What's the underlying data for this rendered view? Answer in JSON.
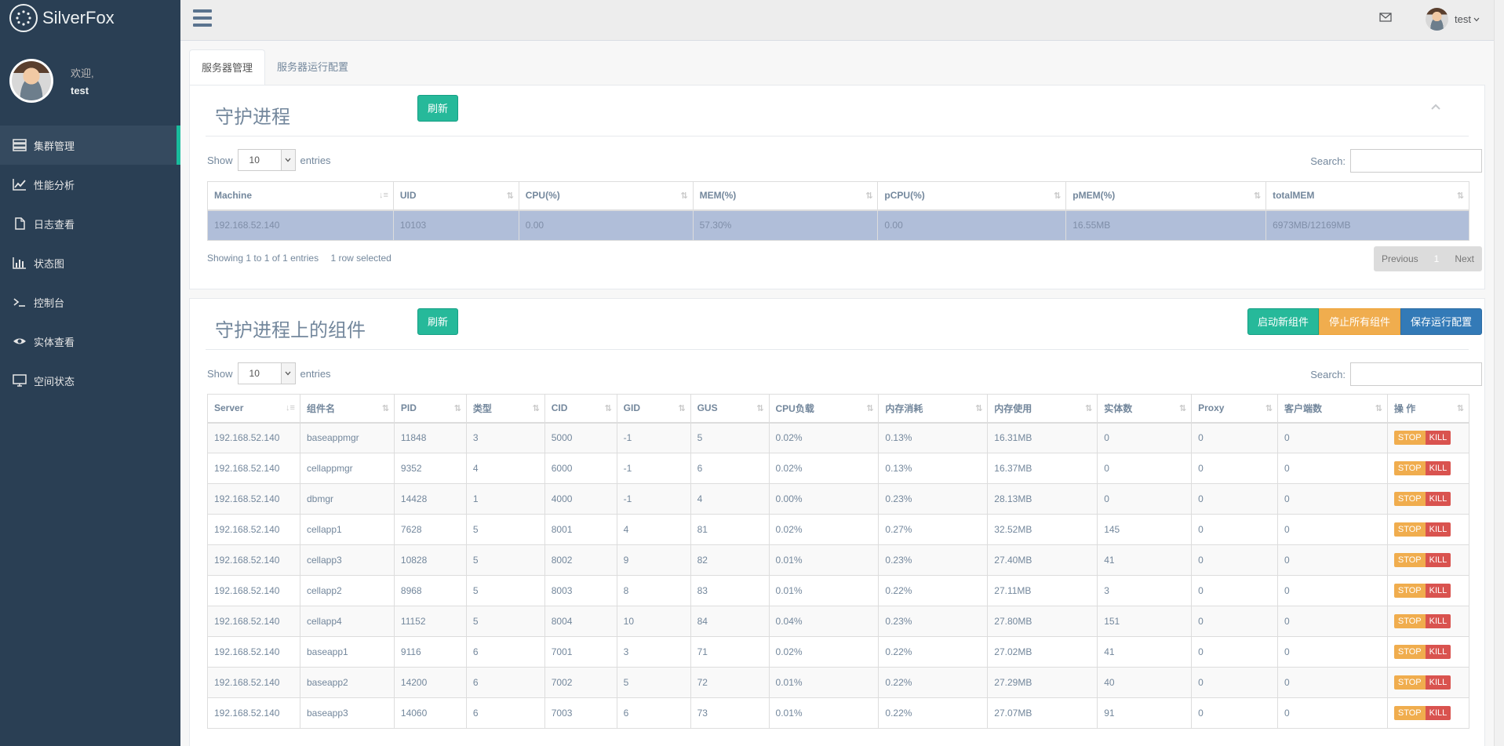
{
  "brand": {
    "name": "SilverFox"
  },
  "profile": {
    "welcome": "欢迎,",
    "username": "test"
  },
  "menu": [
    {
      "label": "集群管理",
      "icon": "server-icon",
      "active": true
    },
    {
      "label": "性能分析",
      "icon": "line-chart-icon",
      "active": false
    },
    {
      "label": "日志查看",
      "icon": "file-icon",
      "active": false
    },
    {
      "label": "状态图",
      "icon": "bar-chart-icon",
      "active": false
    },
    {
      "label": "控制台",
      "icon": "terminal-icon",
      "active": false
    },
    {
      "label": "实体查看",
      "icon": "eye-icon",
      "active": false
    },
    {
      "label": "空间状态",
      "icon": "monitor-icon",
      "active": false
    }
  ],
  "topbar": {
    "user": "test"
  },
  "tabs": [
    {
      "label": "服务器管理",
      "active": true
    },
    {
      "label": "服务器运行配置",
      "active": false
    }
  ],
  "machines": {
    "title": "守护进程",
    "refresh": "刷新",
    "show": "Show",
    "entries_value": "10",
    "entries": "entries",
    "search": "Search:",
    "columns": [
      "Machine",
      "UID",
      "CPU(%)",
      "MEM(%)",
      "pCPU(%)",
      "pMEM(%)",
      "totalMEM"
    ],
    "rows": [
      [
        "192.168.52.140",
        "10103",
        "0.00",
        "57.30%",
        "0.00",
        "16.55MB",
        "6973MB/12169MB"
      ]
    ],
    "info": "Showing 1 to 1 of 1 entries",
    "selected_info": "1 row selected",
    "pager": {
      "prev": "Previous",
      "page": "1",
      "next": "Next"
    }
  },
  "components": {
    "title": "守护进程上的组件",
    "refresh": "刷新",
    "btn_start": "启动新组件",
    "btn_stop_all": "停止所有组件",
    "btn_save": "保存运行配置",
    "show": "Show",
    "entries_value": "10",
    "entries": "entries",
    "search": "Search:",
    "columns": [
      "Server",
      "组件名",
      "PID",
      "类型",
      "CID",
      "GID",
      "GUS",
      "CPU负载",
      "内存消耗",
      "内存使用",
      "实体数",
      "Proxy",
      "客户端数",
      "操 作"
    ],
    "stop": "STOP",
    "kill": "KILL",
    "rows": [
      [
        "192.168.52.140",
        "baseappmgr",
        "11848",
        "3",
        "5000",
        "-1",
        "5",
        "0.02%",
        "0.13%",
        "16.31MB",
        "0",
        "0",
        "0"
      ],
      [
        "192.168.52.140",
        "cellappmgr",
        "9352",
        "4",
        "6000",
        "-1",
        "6",
        "0.02%",
        "0.13%",
        "16.37MB",
        "0",
        "0",
        "0"
      ],
      [
        "192.168.52.140",
        "dbmgr",
        "14428",
        "1",
        "4000",
        "-1",
        "4",
        "0.00%",
        "0.23%",
        "28.13MB",
        "0",
        "0",
        "0"
      ],
      [
        "192.168.52.140",
        "cellapp1",
        "7628",
        "5",
        "8001",
        "4",
        "81",
        "0.02%",
        "0.27%",
        "32.52MB",
        "145",
        "0",
        "0"
      ],
      [
        "192.168.52.140",
        "cellapp3",
        "10828",
        "5",
        "8002",
        "9",
        "82",
        "0.01%",
        "0.23%",
        "27.40MB",
        "41",
        "0",
        "0"
      ],
      [
        "192.168.52.140",
        "cellapp2",
        "8968",
        "5",
        "8003",
        "8",
        "83",
        "0.01%",
        "0.22%",
        "27.11MB",
        "3",
        "0",
        "0"
      ],
      [
        "192.168.52.140",
        "cellapp4",
        "11152",
        "5",
        "8004",
        "10",
        "84",
        "0.04%",
        "0.23%",
        "27.80MB",
        "151",
        "0",
        "0"
      ],
      [
        "192.168.52.140",
        "baseapp1",
        "9116",
        "6",
        "7001",
        "3",
        "71",
        "0.02%",
        "0.22%",
        "27.02MB",
        "41",
        "0",
        "0"
      ],
      [
        "192.168.52.140",
        "baseapp2",
        "14200",
        "6",
        "7002",
        "5",
        "72",
        "0.01%",
        "0.22%",
        "27.29MB",
        "40",
        "0",
        "0"
      ],
      [
        "192.168.52.140",
        "baseapp3",
        "14060",
        "6",
        "7003",
        "6",
        "73",
        "0.01%",
        "0.22%",
        "27.07MB",
        "91",
        "0",
        "0"
      ]
    ]
  }
}
